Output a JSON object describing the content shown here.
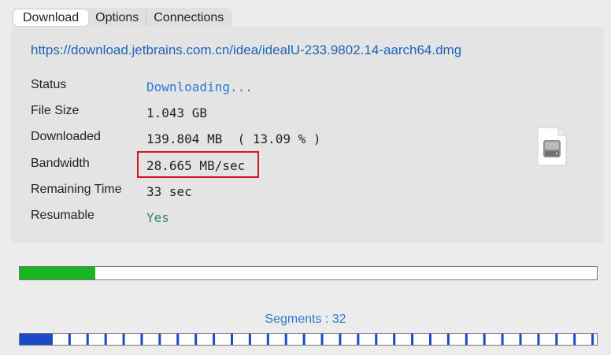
{
  "tabs": [
    "Download",
    "Options",
    "Connections"
  ],
  "active_tab": "Download",
  "url": "https://download.jetbrains.com.cn/idea/idealU-233.9802.14-aarch64.dmg",
  "rows": [
    {
      "label": "Status",
      "value": "Downloading..."
    },
    {
      "label": "File Size",
      "value": "1.043 GB"
    },
    {
      "label": "Downloaded",
      "value": "139.804 MB  ( 13.09 % )"
    },
    {
      "label": "Bandwidth",
      "value": "28.665 MB/sec"
    },
    {
      "label": "Remaining Time",
      "value": "33 sec"
    },
    {
      "label": "Resumable",
      "value": "Yes"
    }
  ],
  "file_icon": "disk-image-icon",
  "progress_fraction": 0.1309,
  "segments_label": "Segments : 32",
  "segments_count": 32,
  "colors": {
    "link": "#1f63b8",
    "status": "#2a79d6",
    "resumable": "#2f8a5a",
    "progress_fill": "#17b520",
    "segment_active": "#1a49c9",
    "highlight_box": "#d0171c"
  }
}
